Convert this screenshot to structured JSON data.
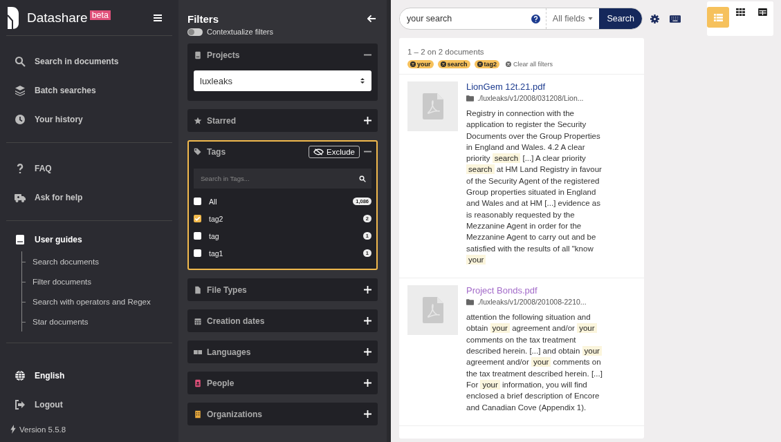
{
  "app": {
    "name": "Datashare",
    "badge": "beta"
  },
  "nav": {
    "main": [
      {
        "label": "Search in documents"
      },
      {
        "label": "Batch searches"
      },
      {
        "label": "Your history"
      }
    ],
    "help": [
      {
        "label": "FAQ"
      },
      {
        "label": "Ask for help"
      }
    ],
    "guides": {
      "label": "User guides",
      "items": [
        "Search documents",
        "Filter documents",
        "Search with operators and Regex",
        "Star documents"
      ]
    },
    "language": "English",
    "logout": "Logout",
    "version": "Version 5.5.8"
  },
  "filters": {
    "title": "Filters",
    "contextualize": {
      "label": "Contextualize filters",
      "on": false
    },
    "panels": [
      {
        "kind": "select",
        "label": "Projects",
        "expanded": true,
        "active": false,
        "value": "luxleaks"
      },
      {
        "kind": "plain",
        "label": "Starred",
        "expanded": false,
        "active": false
      },
      {
        "kind": "list",
        "label": "Tags",
        "expanded": true,
        "active": true,
        "exclude": "Exclude",
        "placeholder": "Search in Tags...",
        "items": [
          {
            "label": "All",
            "count": "1,086",
            "checked": false
          },
          {
            "label": "tag2",
            "count": "2",
            "checked": true
          },
          {
            "label": "tag",
            "count": "1",
            "checked": false
          },
          {
            "label": "tag1",
            "count": "1",
            "checked": false
          }
        ]
      },
      {
        "kind": "plain",
        "label": "File Types",
        "expanded": false,
        "active": false
      },
      {
        "kind": "plain",
        "label": "Creation dates",
        "expanded": false,
        "active": false
      },
      {
        "kind": "plain",
        "label": "Languages",
        "expanded": false,
        "active": false
      },
      {
        "kind": "plain",
        "label": "People",
        "expanded": false,
        "active": false
      },
      {
        "kind": "plain",
        "label": "Organizations",
        "expanded": false,
        "active": false
      }
    ]
  },
  "search": {
    "value": "your search",
    "field": "All fields",
    "button": "Search"
  },
  "views": [
    {
      "selected": true
    },
    {
      "selected": false
    },
    {
      "selected": false
    }
  ],
  "results": {
    "summary": "1 – 2 on 2 documents",
    "chips": [
      "your",
      "search",
      "tag2"
    ],
    "clear": "Clear all filters",
    "documents": [
      {
        "title": "LionGem 12t.21.pdf",
        "visited": false,
        "path": "./luxleaks/v1/2008/031208/Lion...",
        "snippet": [
          {
            "text": "Registry in connection with the application to register the Security Documents over the Group Properties in England and Wales. 4.2 A clear priority",
            "highlighted": false
          },
          {
            "text": "search",
            "highlighted": true
          },
          {
            "text": "[...] A clear priority",
            "highlighted": false
          },
          {
            "text": "search",
            "highlighted": true
          },
          {
            "text": "at HM Land Registry in favour of the Security Agent of the registered Group properties situated in England and Wales and at HM [...] evidence as is reasonably requested by the Mezzanine Agent in order for the Mezzanine Agent to carry out and be satisfied with the results of all \"know",
            "highlighted": false
          },
          {
            "text": "your",
            "highlighted": true
          }
        ]
      },
      {
        "title": "Project Bonds.pdf",
        "visited": true,
        "path": "./luxleaks/v1/2008/201008-2210...",
        "snippet": [
          {
            "text": "attention the following situation and obtain",
            "highlighted": false
          },
          {
            "text": "your",
            "highlighted": true
          },
          {
            "text": "agreement and/or",
            "highlighted": false
          },
          {
            "text": "your",
            "highlighted": true
          },
          {
            "text": "comments on the tax treatment described herein. [...] and obtain",
            "highlighted": false
          },
          {
            "text": "your",
            "highlighted": true
          },
          {
            "text": "agreement and/or",
            "highlighted": false
          },
          {
            "text": "your",
            "highlighted": true
          },
          {
            "text": "comments on the tax treatment described herein. [...] For",
            "highlighted": false
          },
          {
            "text": "your",
            "highlighted": true
          },
          {
            "text": "information, you will find enclosed a brief description of Encore and Canadian Cove (Appendix 1).",
            "highlighted": false
          }
        ]
      }
    ]
  }
}
